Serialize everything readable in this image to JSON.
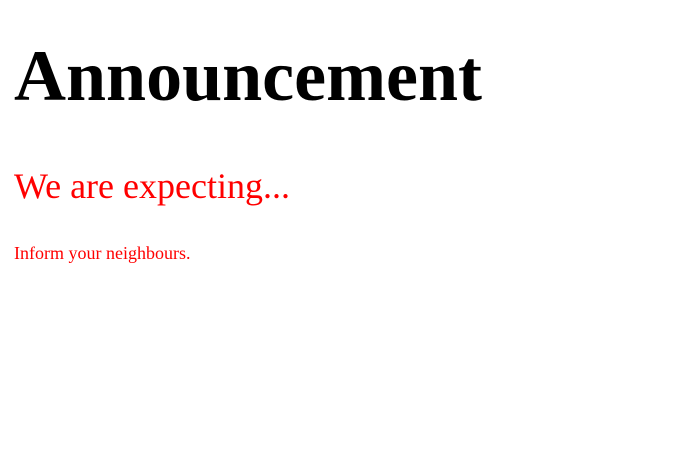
{
  "heading": "Announcement",
  "subheading": "We are expecting...",
  "paragraph": "Inform your neighbours.",
  "colors": {
    "heading": "#000000",
    "accent": "#ff0000"
  }
}
